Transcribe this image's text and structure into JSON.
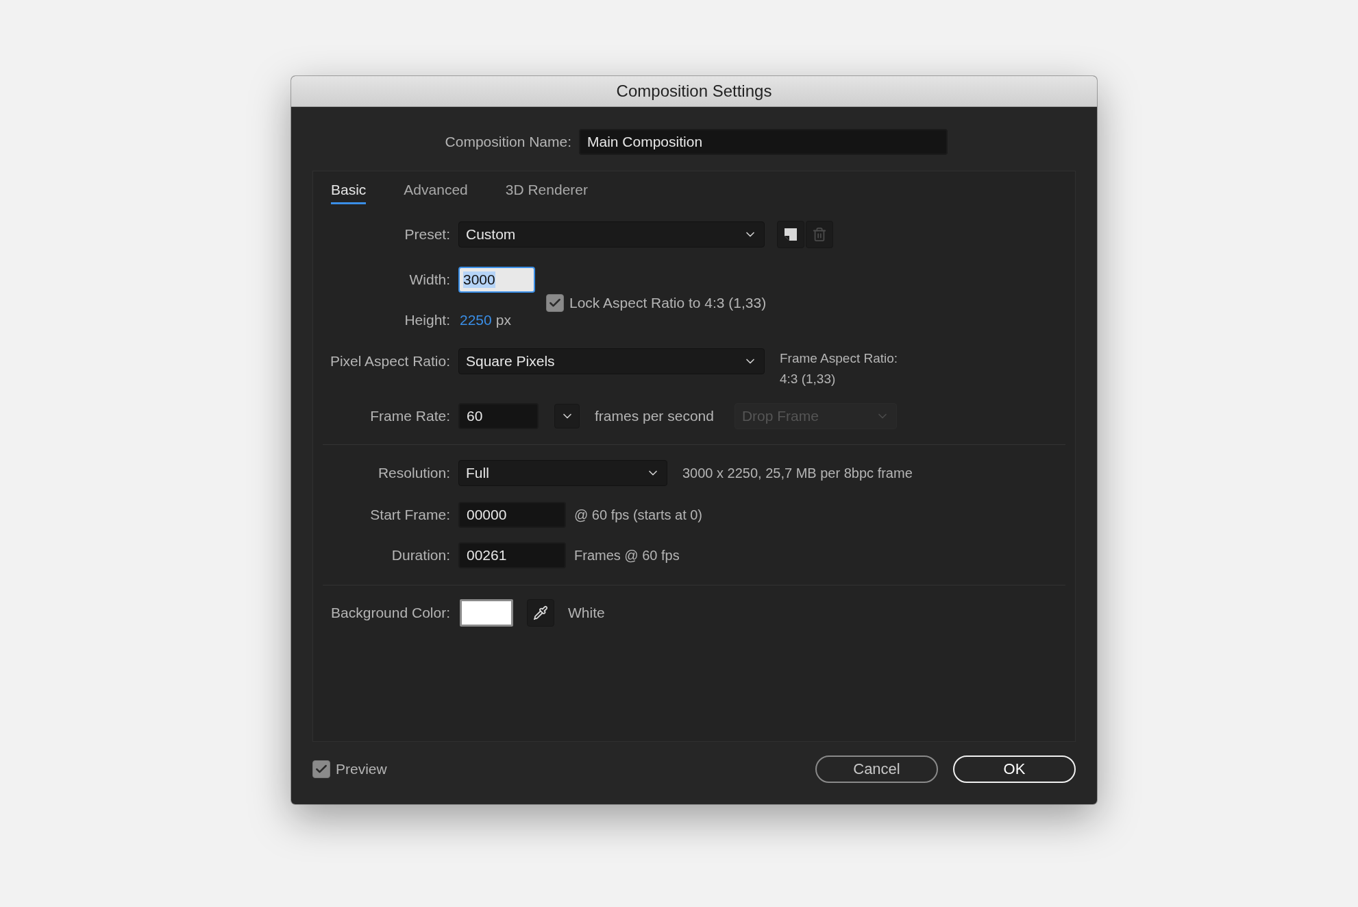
{
  "window": {
    "title": "Composition Settings"
  },
  "composition_name": {
    "label": "Composition Name:",
    "value": "Main Composition"
  },
  "tabs": [
    {
      "label": "Basic",
      "selected": true
    },
    {
      "label": "Advanced",
      "selected": false
    },
    {
      "label": "3D Renderer",
      "selected": false
    }
  ],
  "preset": {
    "label": "Preset:",
    "value": "Custom"
  },
  "preset_buttons": [
    {
      "kind": "save",
      "disabled": false
    },
    {
      "kind": "delete",
      "disabled": true
    }
  ],
  "width": {
    "label": "Width:",
    "value": "3000",
    "focused": true
  },
  "lock_aspect": {
    "label": "Lock Aspect Ratio to 4:3 (1,33)",
    "checked": true
  },
  "height": {
    "label": "Height:",
    "value": "2250",
    "unit": "px"
  },
  "pixel_aspect_ratio": {
    "label": "Pixel Aspect Ratio:",
    "value": "Square Pixels",
    "note_lines": [
      "Frame Aspect Ratio:",
      "4:3 (1,33)"
    ]
  },
  "frame_rate": {
    "label": "Frame Rate:",
    "value": "60",
    "unit": "frames per second",
    "drop_frame": {
      "value": "Drop Frame",
      "disabled": true
    }
  },
  "resolution": {
    "label": "Resolution:",
    "value": "Full",
    "info": "3000 x 2250, 25,7 MB per 8bpc frame"
  },
  "start_frame": {
    "label": "Start Frame:",
    "value": "00000",
    "info": "@ 60 fps (starts at 0)"
  },
  "duration": {
    "label": "Duration:",
    "value": "00261",
    "info": "Frames @ 60 fps"
  },
  "background_color": {
    "label": "Background Color:",
    "color": "#ffffff",
    "name": "White"
  },
  "preview": {
    "label": "Preview",
    "checked": true
  },
  "buttons": [
    {
      "label": "Cancel",
      "primary": false
    },
    {
      "label": "OK",
      "primary": true
    }
  ]
}
